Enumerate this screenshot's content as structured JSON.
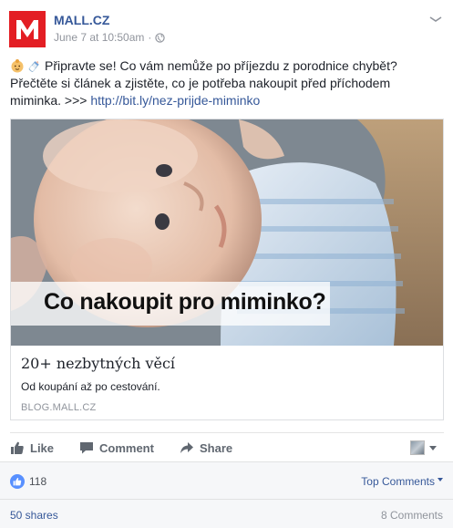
{
  "header": {
    "page_name": "MALL.CZ",
    "timestamp": "June 7 at 10:50am",
    "separator": "·",
    "logo_letter": "M",
    "brand_color": "#e31e24"
  },
  "message": {
    "text": "Připravte se! Co vám nemůže po příjezdu z porodnice chybět? Přečtěte si článek a zjistěte, co je potřeba nakoupit před příchodem miminka. >>> ",
    "link": "http://bit.ly/nez-prijde-miminko",
    "emojis": [
      "baby-face-icon",
      "baby-bottle-icon"
    ]
  },
  "link_preview": {
    "image_overlay_text": "Co nakoupit pro miminko?",
    "title": "20+ nezbytných věcí",
    "description": "Od koupání až po cestování.",
    "domain": "BLOG.MALL.CZ"
  },
  "actions": {
    "like_label": "Like",
    "comment_label": "Comment",
    "share_label": "Share"
  },
  "footer": {
    "reaction_count": "118",
    "top_comments_label": "Top Comments",
    "shares_label": "50 shares",
    "comments_label": "8 Comments",
    "link_color": "#365899"
  }
}
